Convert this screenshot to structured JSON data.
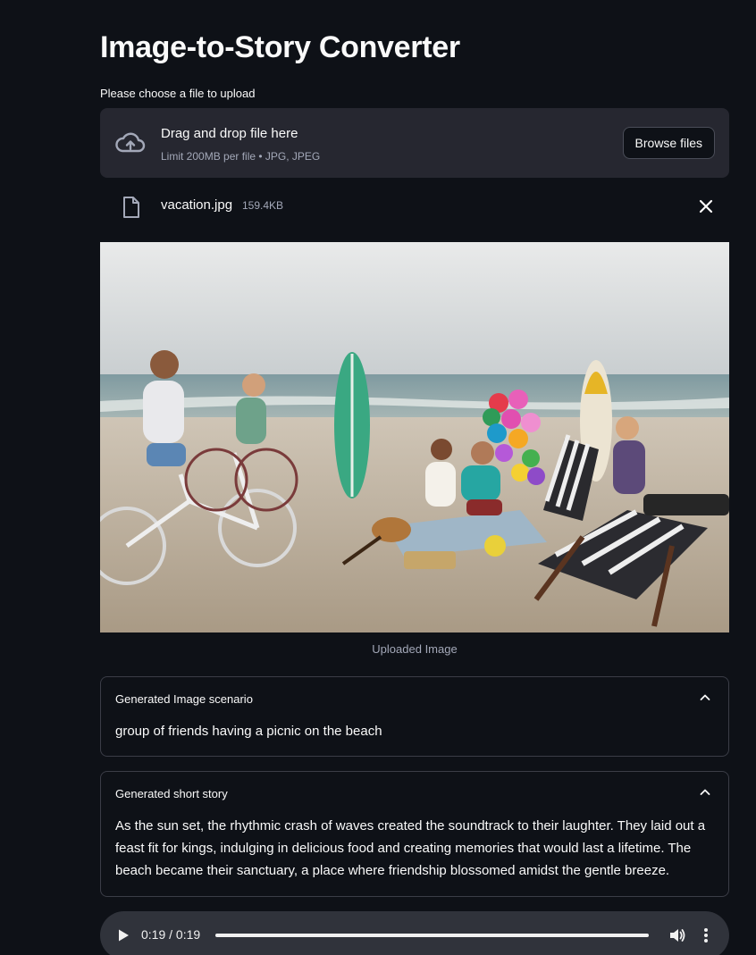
{
  "app": {
    "title": "Image-to-Story Converter"
  },
  "uploader": {
    "label": "Please choose a file to upload",
    "drop_title": "Drag and drop file here",
    "drop_limits": "Limit 200MB per file • JPG, JPEG",
    "browse_label": "Browse files",
    "icon": "cloud-upload-icon"
  },
  "uploaded_file": {
    "name": "vacation.jpg",
    "size": "159.4KB",
    "icon": "file-icon",
    "remove_icon": "close-icon"
  },
  "image": {
    "caption": "Uploaded Image"
  },
  "scenario": {
    "header": "Generated Image scenario",
    "text": "group of friends having a picnic on the beach"
  },
  "story": {
    "header": "Generated short story",
    "text": "As the sun set, the rhythmic crash of waves created the soundtrack to their laughter. They laid out a feast fit for kings, indulging in delicious food and creating memories that would last a lifetime. The beach became their sanctuary, a place where friendship blossomed amidst the gentle breeze."
  },
  "audio": {
    "time": "0:19 / 0:19",
    "progress": 1.0
  },
  "colors": {
    "background": "#0e1117",
    "panel": "#262730",
    "text": "#fafafa",
    "muted": "#a3a8b8",
    "border": "#3b3d47"
  }
}
